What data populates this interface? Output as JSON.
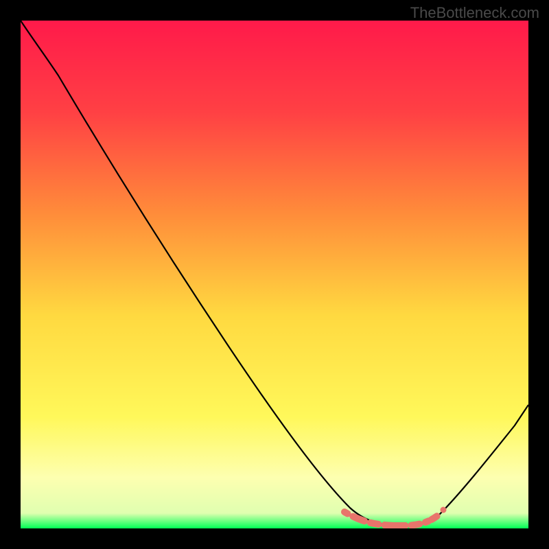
{
  "watermark": "TheBottleneck.com",
  "chart_data": {
    "type": "line",
    "title": "",
    "xlabel": "",
    "ylabel": "",
    "xlim": [
      0,
      100
    ],
    "ylim": [
      0,
      100
    ],
    "series": [
      {
        "name": "bottleneck-curve",
        "color": "#000000",
        "x": [
          0,
          5,
          10,
          15,
          20,
          25,
          30,
          35,
          40,
          45,
          50,
          55,
          60,
          62,
          65,
          70,
          75,
          80,
          82,
          85,
          90,
          95,
          100
        ],
        "y": [
          100,
          95,
          88,
          80,
          72,
          64,
          56,
          48,
          40,
          32,
          24,
          16,
          8,
          5,
          2,
          0.5,
          0.5,
          1,
          3,
          8,
          16,
          25,
          34
        ]
      },
      {
        "name": "optimal-range-highlight",
        "color": "#e8746b",
        "x": [
          62,
          65,
          68,
          71,
          74,
          77,
          80,
          82
        ],
        "y": [
          5,
          2,
          1,
          0.5,
          0.5,
          0.7,
          1,
          3
        ]
      }
    ],
    "background_gradient": {
      "top": "#ff1a4a",
      "upper_mid": "#ff8c3a",
      "mid": "#ffd940",
      "lower_mid": "#fff85a",
      "bottom": "#00ff55"
    }
  }
}
